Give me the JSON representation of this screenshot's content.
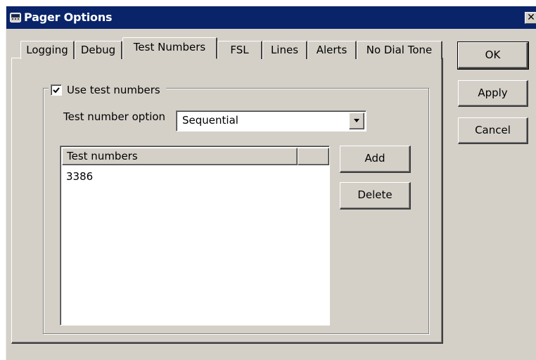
{
  "window": {
    "title": "Pager Options",
    "close_label": "✕"
  },
  "tabs": [
    {
      "label": "Logging"
    },
    {
      "label": "Debug"
    },
    {
      "label": "Test Numbers",
      "active": true
    },
    {
      "label": "FSL"
    },
    {
      "label": "Lines"
    },
    {
      "label": "Alerts"
    },
    {
      "label": "No Dial Tone"
    }
  ],
  "buttons": {
    "ok": "OK",
    "apply": "Apply",
    "cancel": "Cancel",
    "add": "Add",
    "delete": "Delete"
  },
  "test_numbers_tab": {
    "use_test_numbers_label": "Use test numbers",
    "use_test_numbers_checked": true,
    "option_label": "Test number option",
    "option_selected": "Sequential",
    "list_header": "Test numbers",
    "list_items": [
      "3386"
    ]
  },
  "icons": {
    "title_icon": "pager-icon",
    "check": "checkmark-icon",
    "dropdown": "chevron-down-icon"
  },
  "colors": {
    "titlebar": "#0a246a",
    "face": "#d4d0c8"
  }
}
